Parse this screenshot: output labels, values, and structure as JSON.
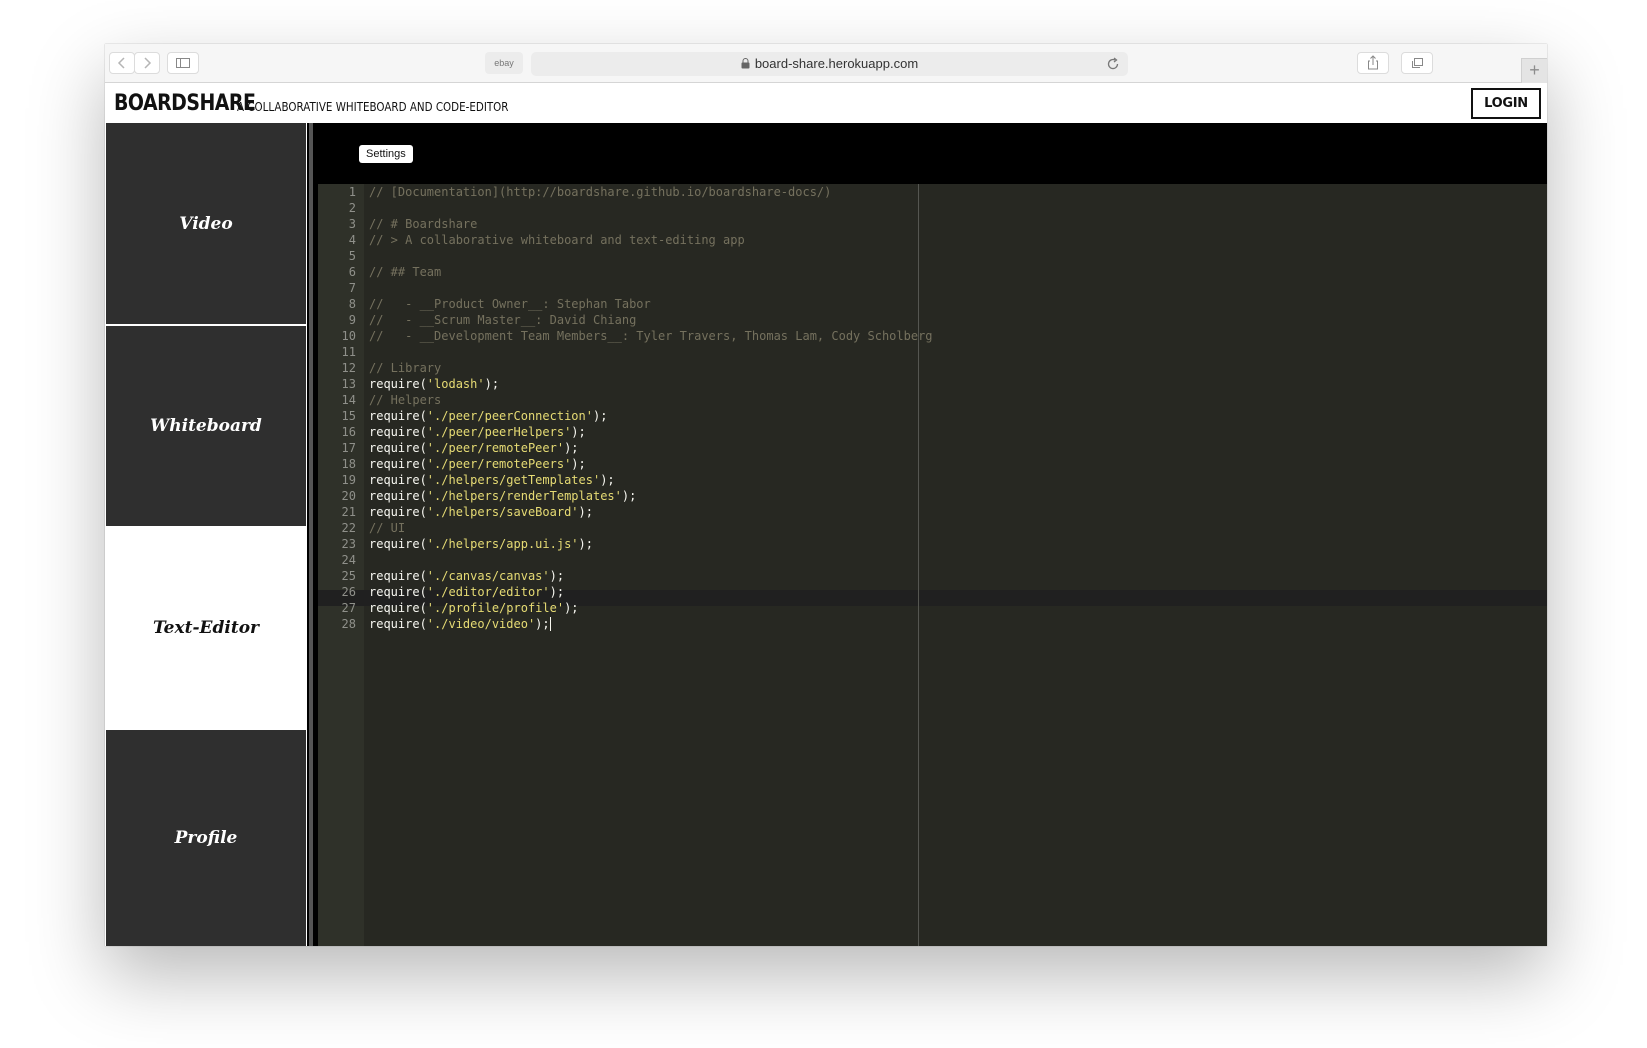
{
  "browser": {
    "favorite_label": "ebay",
    "url": "board-share.herokuapp.com",
    "new_tab_symbol": "+"
  },
  "header": {
    "brand": "BOARDSHARE",
    "tagline": "A COLLABORATIVE WHITEBOARD AND CODE-EDITOR",
    "login_label": "LOGIN"
  },
  "sidebar": {
    "items": [
      {
        "label": "Video",
        "active": false
      },
      {
        "label": "Whiteboard",
        "active": false
      },
      {
        "label": "Text-Editor",
        "active": true
      },
      {
        "label": "Profile",
        "active": false
      }
    ]
  },
  "editor": {
    "settings_label": "Settings",
    "colors": {
      "background": "#272822",
      "comment": "#75715e",
      "string": "#e6db74",
      "text": "#f8f8f2"
    },
    "lines": [
      {
        "n": "1",
        "kind": "comment",
        "text": "// [Documentation](http://boardshare.github.io/boardshare-docs/)"
      },
      {
        "n": "2",
        "kind": "comment",
        "text": ""
      },
      {
        "n": "3",
        "kind": "comment",
        "text": "// # Boardshare"
      },
      {
        "n": "4",
        "kind": "comment",
        "text": "// > A collaborative whiteboard and text-editing app"
      },
      {
        "n": "5",
        "kind": "comment",
        "text": ""
      },
      {
        "n": "6",
        "kind": "comment",
        "text": "// ## Team"
      },
      {
        "n": "7",
        "kind": "comment",
        "text": ""
      },
      {
        "n": "8",
        "kind": "comment",
        "text": "//   - __Product Owner__: Stephan Tabor"
      },
      {
        "n": "9",
        "kind": "comment",
        "text": "//   - __Scrum Master__: David Chiang"
      },
      {
        "n": "10",
        "kind": "comment",
        "text": "//   - __Development Team Members__: Tyler Travers, Thomas Lam, Cody Scholberg"
      },
      {
        "n": "11",
        "kind": "comment",
        "text": ""
      },
      {
        "n": "12",
        "kind": "comment",
        "text": "// Library"
      },
      {
        "n": "13",
        "kind": "require",
        "pre": "require(",
        "str": "'lodash'",
        "post": ");"
      },
      {
        "n": "14",
        "kind": "comment",
        "text": "// Helpers"
      },
      {
        "n": "15",
        "kind": "require",
        "pre": "require(",
        "str": "'./peer/peerConnection'",
        "post": ");"
      },
      {
        "n": "16",
        "kind": "require",
        "pre": "require(",
        "str": "'./peer/peerHelpers'",
        "post": ");"
      },
      {
        "n": "17",
        "kind": "require",
        "pre": "require(",
        "str": "'./peer/remotePeer'",
        "post": ");"
      },
      {
        "n": "18",
        "kind": "require",
        "pre": "require(",
        "str": "'./peer/remotePeers'",
        "post": ");"
      },
      {
        "n": "19",
        "kind": "require",
        "pre": "require(",
        "str": "'./helpers/getTemplates'",
        "post": ");"
      },
      {
        "n": "20",
        "kind": "require",
        "pre": "require(",
        "str": "'./helpers/renderTemplates'",
        "post": ");"
      },
      {
        "n": "21",
        "kind": "require",
        "pre": "require(",
        "str": "'./helpers/saveBoard'",
        "post": ");"
      },
      {
        "n": "22",
        "kind": "comment",
        "text": "// UI"
      },
      {
        "n": "23",
        "kind": "require",
        "pre": "require(",
        "str": "'./helpers/app.ui.js'",
        "post": ");"
      },
      {
        "n": "24",
        "kind": "comment",
        "text": ""
      },
      {
        "n": "25",
        "kind": "require",
        "pre": "require(",
        "str": "'./canvas/canvas'",
        "post": ");"
      },
      {
        "n": "26",
        "kind": "require",
        "pre": "require(",
        "str": "'./editor/editor'",
        "post": ");"
      },
      {
        "n": "27",
        "kind": "require",
        "pre": "require(",
        "str": "'./profile/profile'",
        "post": ");"
      },
      {
        "n": "28",
        "kind": "require",
        "pre": "require(",
        "str": "'./video/video'",
        "post": ");",
        "cursor": true
      }
    ]
  }
}
